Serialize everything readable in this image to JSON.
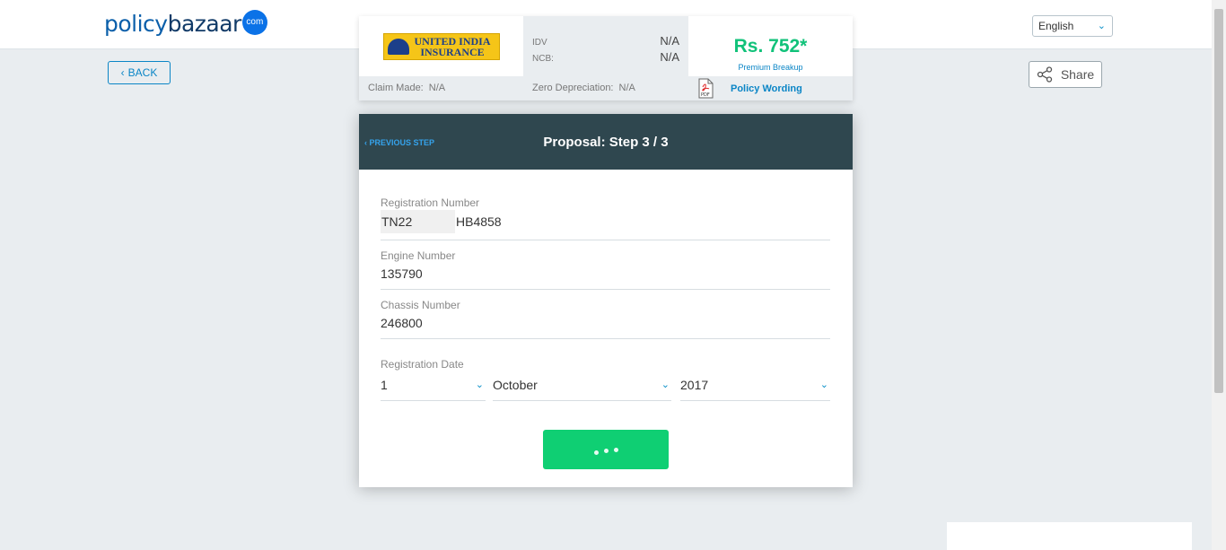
{
  "header": {
    "logo": {
      "part1": "policy",
      "part2": "bazaar",
      "badge": "com"
    },
    "language": "English"
  },
  "nav": {
    "back_label": "BACK",
    "share_label": "Share"
  },
  "plan": {
    "insurer_name_line1": "UNITED INDIA",
    "insurer_name_line2": "INSURANCE",
    "idv_key": "IDV",
    "idv_value": "N/A",
    "ncb_key": "NCB:",
    "ncb_value": "N/A",
    "price": "Rs. 752*",
    "premium_breakup": "Premium Breakup",
    "claim_made_key": "Claim Made:",
    "claim_made_value": "N/A",
    "zero_dep_key": "Zero Depreciation:",
    "zero_dep_value": "N/A",
    "policy_wording": "Policy Wording",
    "pdf_label": "PDF"
  },
  "form": {
    "previous_step": "PREVIOUS STEP",
    "title": "Proposal: Step 3 / 3",
    "registration_label": "Registration Number",
    "registration_prefix": "TN22",
    "registration_suffix": "HB4858",
    "engine_label": "Engine Number",
    "engine_value": "135790",
    "chassis_label": "Chassis Number",
    "chassis_value": "246800",
    "reg_date_label": "Registration Date",
    "reg_day": "1",
    "reg_month": "October",
    "reg_year": "2017"
  },
  "colors": {
    "brand_blue": "#0a85c6",
    "price_green": "#11c27a",
    "header_dark": "#2f474f",
    "submit_green": "#0fcf73"
  }
}
